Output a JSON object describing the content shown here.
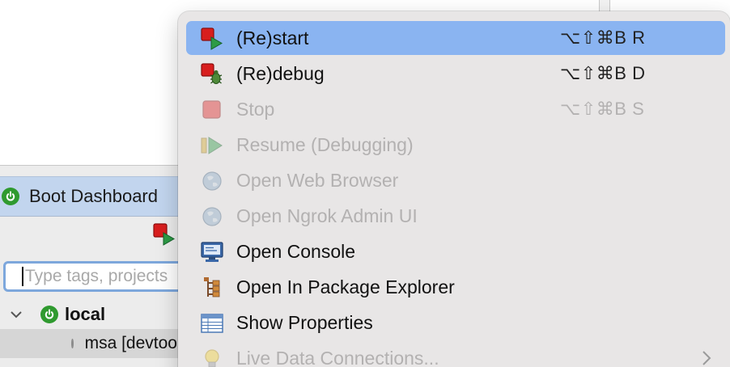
{
  "background_view": {
    "tab_label": "Boot Dashboard",
    "search_placeholder": "Type tags, projects",
    "tree": {
      "local_label": "local",
      "app_label": "msa [devtools]"
    }
  },
  "menu": {
    "items": [
      {
        "label": "(Re)start",
        "shortcut": "⌥⇧⌘B R",
        "icon": "restart-icon",
        "state": "highlighted"
      },
      {
        "label": "(Re)debug",
        "shortcut": "⌥⇧⌘B D",
        "icon": "debug-bug-icon",
        "state": "enabled"
      },
      {
        "label": "Stop",
        "shortcut": "⌥⇧⌘B S",
        "icon": "stop-icon",
        "state": "disabled"
      },
      {
        "label": "Resume (Debugging)",
        "shortcut": "",
        "icon": "resume-icon",
        "state": "disabled"
      },
      {
        "label": "Open Web Browser",
        "shortcut": "",
        "icon": "globe-icon",
        "state": "disabled"
      },
      {
        "label": "Open Ngrok Admin UI",
        "shortcut": "",
        "icon": "globe-icon",
        "state": "disabled"
      },
      {
        "label": "Open Console",
        "shortcut": "",
        "icon": "console-monitor-icon",
        "state": "enabled"
      },
      {
        "label": "Open In Package Explorer",
        "shortcut": "",
        "icon": "package-explorer-icon",
        "state": "enabled"
      },
      {
        "label": "Show Properties",
        "shortcut": "",
        "icon": "properties-table-icon",
        "state": "enabled"
      },
      {
        "label": "Live Data Connections...",
        "shortcut": "",
        "icon": "lightbulb-icon",
        "state": "disabled",
        "submenu": true
      }
    ]
  },
  "colors": {
    "menu_background": "#e8e6e6",
    "highlight": "#8ab4f1",
    "disabled_text": "#b3b1b1",
    "boot_green": "#2f9a2f"
  }
}
